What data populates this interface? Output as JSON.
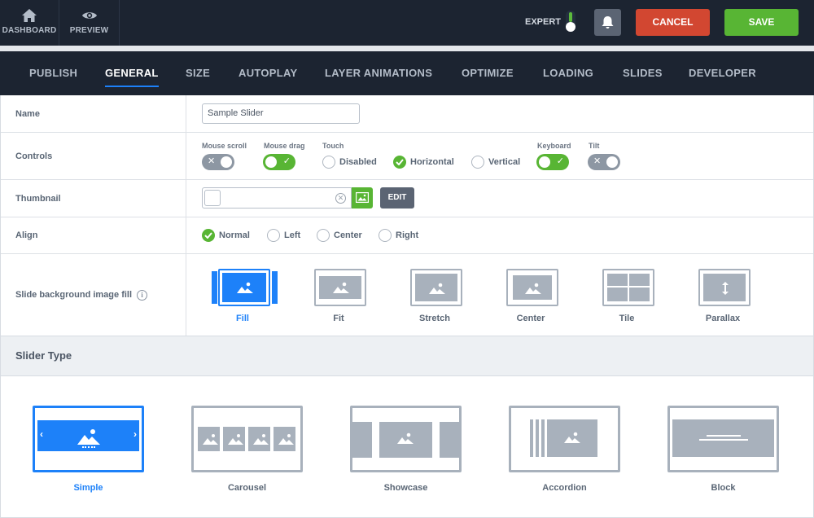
{
  "topbar": {
    "dashboard_label": "DASHBOARD",
    "preview_label": "PREVIEW",
    "expert_label": "EXPERT",
    "cancel_label": "CANCEL",
    "save_label": "SAVE",
    "colors": {
      "bar": "#1c2431",
      "cancel": "#d24731",
      "save": "#58b534",
      "accent": "#1d81f9"
    }
  },
  "tabs": [
    {
      "label": "PUBLISH"
    },
    {
      "label": "GENERAL",
      "active": true
    },
    {
      "label": "SIZE"
    },
    {
      "label": "AUTOPLAY"
    },
    {
      "label": "LAYER ANIMATIONS"
    },
    {
      "label": "OPTIMIZE"
    },
    {
      "label": "LOADING"
    },
    {
      "label": "SLIDES"
    },
    {
      "label": "DEVELOPER"
    }
  ],
  "form": {
    "name": {
      "label": "Name",
      "value": "Sample Slider"
    },
    "controls": {
      "label": "Controls",
      "mouse_scroll": {
        "label": "Mouse scroll",
        "state": "off"
      },
      "mouse_drag": {
        "label": "Mouse drag",
        "state": "on"
      },
      "touch": {
        "label": "Touch",
        "options": [
          "Disabled",
          "Horizontal",
          "Vertical"
        ],
        "selected": "Horizontal"
      },
      "keyboard": {
        "label": "Keyboard",
        "state": "on"
      },
      "tilt": {
        "label": "Tilt",
        "state": "off"
      }
    },
    "thumbnail": {
      "label": "Thumbnail",
      "value": "",
      "edit_label": "EDIT"
    },
    "align": {
      "label": "Align",
      "options": [
        "Normal",
        "Left",
        "Center",
        "Right"
      ],
      "selected": "Normal"
    },
    "bg_fill": {
      "label": "Slide background image fill",
      "info_glyph": "i",
      "options": [
        "Fill",
        "Fit",
        "Stretch",
        "Center",
        "Tile",
        "Parallax"
      ],
      "selected": "Fill"
    }
  },
  "slider_type": {
    "title": "Slider Type",
    "options": [
      "Simple",
      "Carousel",
      "Showcase",
      "Accordion",
      "Block"
    ],
    "selected": "Simple"
  }
}
